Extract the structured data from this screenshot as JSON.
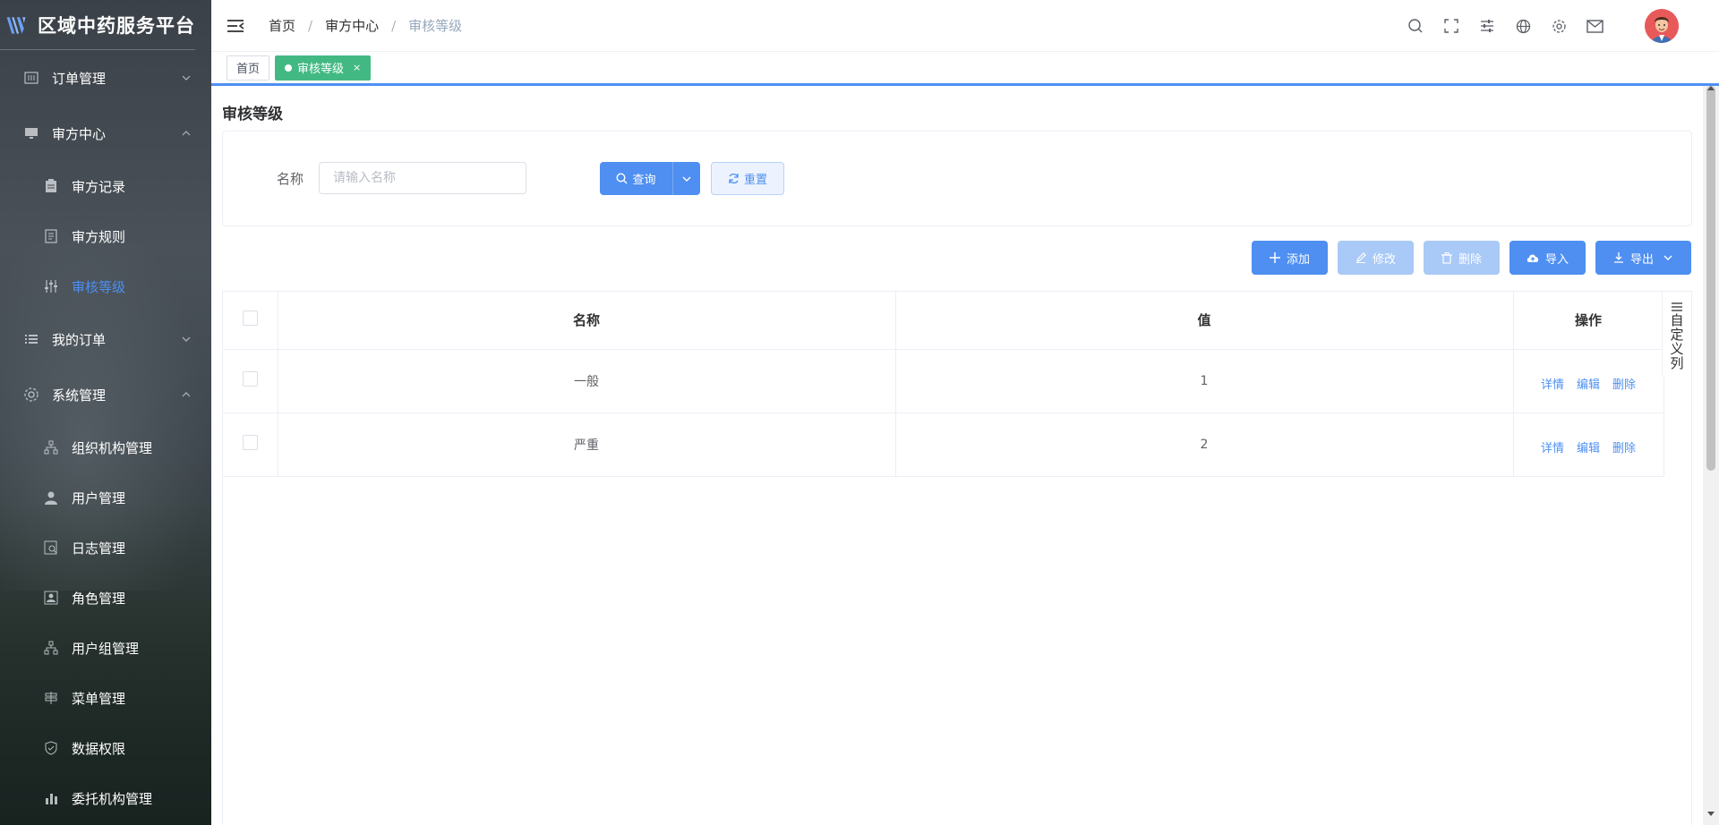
{
  "app": {
    "title": "区域中药服务平台"
  },
  "sidebar": {
    "items": [
      {
        "label": "订单管理",
        "level": 1,
        "expanded": false
      },
      {
        "label": "审方中心",
        "level": 1,
        "expanded": true
      },
      {
        "label": "审方记录",
        "level": 2
      },
      {
        "label": "审方规则",
        "level": 2
      },
      {
        "label": "审核等级",
        "level": 2,
        "active": true
      },
      {
        "label": "我的订单",
        "level": 1,
        "expanded": false
      },
      {
        "label": "系统管理",
        "level": 1,
        "expanded": true
      },
      {
        "label": "组织机构管理",
        "level": 2
      },
      {
        "label": "用户管理",
        "level": 2
      },
      {
        "label": "日志管理",
        "level": 2
      },
      {
        "label": "角色管理",
        "level": 2
      },
      {
        "label": "用户组管理",
        "level": 2
      },
      {
        "label": "菜单管理",
        "level": 2
      },
      {
        "label": "数据权限",
        "level": 2
      },
      {
        "label": "委托机构管理",
        "level": 2
      }
    ]
  },
  "header": {
    "breadcrumb": [
      "首页",
      "审方中心",
      "审核等级"
    ]
  },
  "tags": [
    {
      "label": "首页",
      "active": false
    },
    {
      "label": "审核等级",
      "active": true,
      "close": "×"
    }
  ],
  "main": {
    "title": "审核等级",
    "search": {
      "label": "名称",
      "placeholder": "请输入名称",
      "value": "",
      "query_label": "查询",
      "reset_label": "重置"
    },
    "toolbar": {
      "add": "添加",
      "edit": "修改",
      "delete": "删除",
      "import": "导入",
      "export": "导出"
    },
    "table": {
      "columns": [
        "名称",
        "值",
        "操作"
      ],
      "rows": [
        {
          "name": "一般",
          "value": "1",
          "ops": [
            "详情",
            "编辑",
            "删除"
          ]
        },
        {
          "name": "严重",
          "value": "2",
          "ops": [
            "详情",
            "编辑",
            "删除"
          ]
        }
      ],
      "custom_columns_label": "自定义列"
    }
  },
  "colors": {
    "accent": "#4e8ff1",
    "tag_active": "#42b983"
  }
}
